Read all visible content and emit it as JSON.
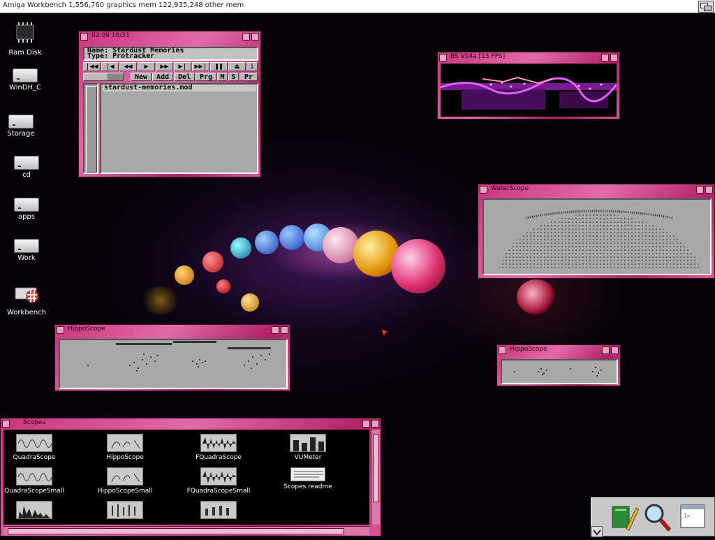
{
  "screen": {
    "title": "Amiga Workbench  1,556,760 graphics mem  122,935,248 other mem"
  },
  "desktop_icons": [
    {
      "label": "Ram Disk",
      "icon": "ram-chip-icon"
    },
    {
      "label": "WinDH_C",
      "icon": "hard-drive-icon"
    },
    {
      "label": "Storage",
      "icon": "hard-drive-icon"
    },
    {
      "label": "cd",
      "icon": "hard-drive-icon"
    },
    {
      "label": "apps",
      "icon": "hard-drive-icon"
    },
    {
      "label": "Work",
      "icon": "hard-drive-icon"
    },
    {
      "label": "Workbench",
      "icon": "boing-drive-icon"
    }
  ],
  "player": {
    "title": "02:09 16/31",
    "name_line": "Name: Stardust Memories",
    "type_line": "Type: Protracker",
    "transport": [
      "|◀◀",
      "|◀",
      "◀◀",
      "▶",
      "▶▶",
      "▶|",
      "▶▶|",
      "❚❚",
      "⏏",
      "i"
    ],
    "list_buttons": [
      "New",
      "Add",
      "Del",
      "Prg",
      "M",
      "S",
      "Pr"
    ],
    "playlist": [
      "stardust-memories.mod"
    ]
  },
  "bs_window": {
    "title": "BS V14a [13 FPS]"
  },
  "water_scope": {
    "title": "WaterScope"
  },
  "hippo_large": {
    "title": "HippoScope"
  },
  "hippo_small": {
    "title": "HippoScope"
  },
  "scopes_drawer": {
    "title": "Scopes",
    "icons": [
      {
        "label": "QuadraScope",
        "icon": "scope-wave-icon"
      },
      {
        "label": "HippoScope",
        "icon": "scope-hippo-icon"
      },
      {
        "label": "FQuadraScope",
        "icon": "scope-filled-icon"
      },
      {
        "label": "VUMeter",
        "icon": "vu-meter-icon"
      },
      {
        "label": "QuadraScopeSmall",
        "icon": "scope-wave-icon"
      },
      {
        "label": "HippoScopeSmall",
        "icon": "scope-hippo-icon"
      },
      {
        "label": "FQuadraScopeSmall",
        "icon": "scope-filled-icon"
      },
      {
        "label": "Scopes.readme",
        "icon": "text-document-icon"
      }
    ]
  },
  "dock": {
    "icons": [
      "notepad-pencil-icon",
      "magnifier-icon",
      "shell-window-icon"
    ]
  },
  "colors": {
    "frame": "#c8357c",
    "frame_light": "#e26aa8",
    "panel": "#a8a8a8",
    "desktop": "#050208"
  }
}
